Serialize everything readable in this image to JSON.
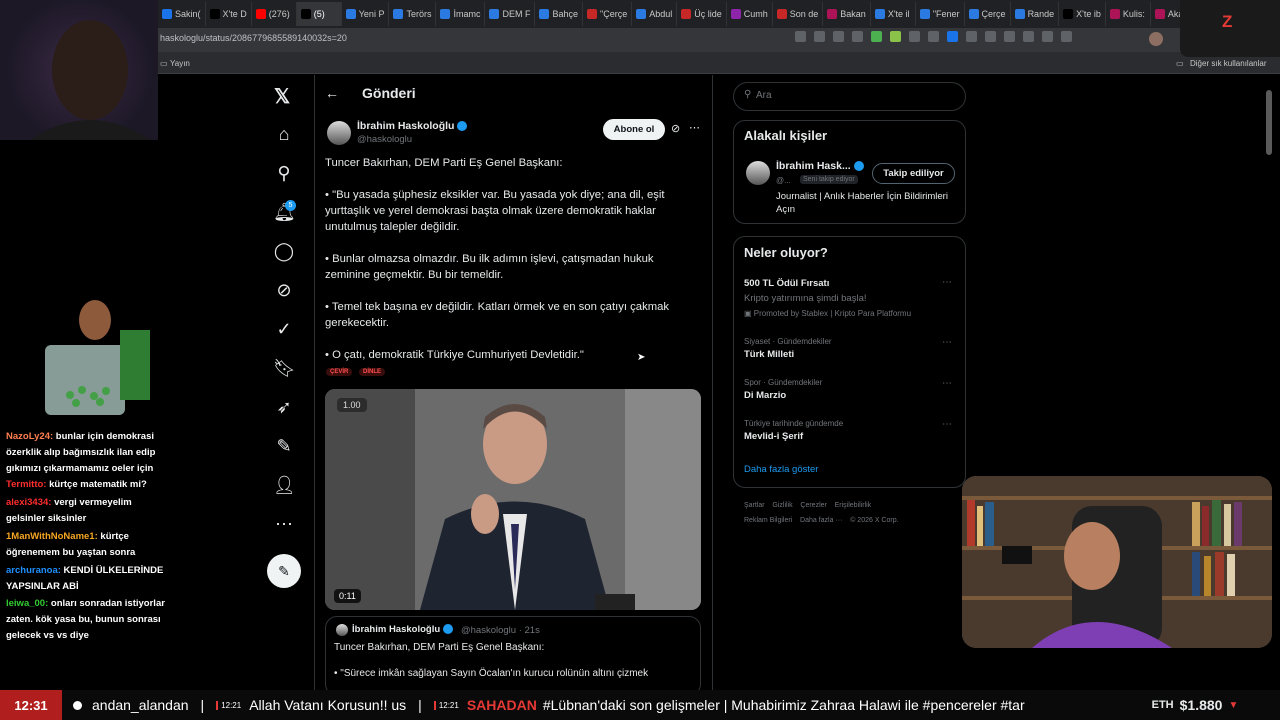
{
  "browser": {
    "tabs": [
      {
        "label": "Sakin(",
        "color": "#1a73e8"
      },
      {
        "label": "X'te D",
        "color": "#000000"
      },
      {
        "label": "(276)",
        "color": "#ff0000"
      },
      {
        "label": "(5)",
        "color": "#000000",
        "active": true
      },
      {
        "label": "Yeni P",
        "color": "#2a7ae2"
      },
      {
        "label": "Terörs",
        "color": "#2a7ae2"
      },
      {
        "label": "İmamc",
        "color": "#2a7ae2"
      },
      {
        "label": "DEM F",
        "color": "#2a7ae2"
      },
      {
        "label": "Bahçe",
        "color": "#2a7ae2"
      },
      {
        "label": "\"Çerçe",
        "color": "#c62828"
      },
      {
        "label": "Abdul",
        "color": "#2a7ae2"
      },
      {
        "label": "Üç lide",
        "color": "#c62828"
      },
      {
        "label": "Cumh",
        "color": "#8e24aa"
      },
      {
        "label": "Son de",
        "color": "#c62828"
      },
      {
        "label": "Bakan",
        "color": "#ad1457"
      },
      {
        "label": "X'te il",
        "color": "#2a7ae2"
      },
      {
        "label": "\"Fener",
        "color": "#2a7ae2"
      },
      {
        "label": "Çerçe",
        "color": "#2a7ae2"
      },
      {
        "label": "Rande",
        "color": "#2a7ae2"
      },
      {
        "label": "X'te ib",
        "color": "#000000"
      },
      {
        "label": "Kulis:",
        "color": "#ad1457"
      },
      {
        "label": "Akary",
        "color": "#ad1457"
      }
    ],
    "url": "haskologlu/status/2086779685589140032s=20",
    "bookmark_left": "Yayın",
    "bookmark_right": "Diğer sık kullanılanlar"
  },
  "x": {
    "header": "Gönderi",
    "author_name": "İbrahim Haskoloğlu",
    "author_handle": "@haskologlu",
    "subscribe": "Abone ol",
    "tweet_lines": [
      "Tuncer Bakırhan, DEM Parti Eş Genel Başkanı:",
      "• \"Bu yasada şüphesiz eksikler var. Bu yasada yok diye; ana dil, eşit yurttaşlık ve yerel demokrasi başta olmak üzere demokratik haklar unutulmuş talepler değildir.",
      "• Bunlar olmazsa olmazdır. Bu ilk adımın işlevi, çatışmadan hukuk zeminine geçmektir. Bu bir temeldir.",
      "• Temel tek başına ev değildir. Katları örmek ve en son çatıyı çakmak gerekecektir.",
      "• O çatı, demokratik Türkiye Cumhuriyeti Devletidir.\""
    ],
    "translate": "ÇEVİR",
    "listen": "DİNLE",
    "video_speed": "1.00",
    "video_time": "0:11",
    "quoted": {
      "name": "İbrahim Haskoloğlu",
      "handle": "@haskologlu · 21s",
      "line1": "Tuncer Bakırhan, DEM Parti Eş Genel Başkanı:",
      "line2": "• \"Sürece imkân sağlayan Sayın Öcalan'ın kurucu rolünün altını çizmek"
    },
    "notification_count": "5",
    "search_placeholder": "Ara",
    "relevant_title": "Alakalı kişiler",
    "relevant_name": "İbrahim Hask...",
    "relevant_handle": "@...",
    "relevant_follows_you": "Seni takip ediyor",
    "relevant_bio": "Journalist | Anlık Haberler İçin Bildirimleri Açın",
    "following_btn": "Takip ediliyor",
    "trends_title": "Neler oluyor?",
    "trends": [
      {
        "cat": "",
        "title": "500 TL Ödül Fırsatı",
        "sub": "Kripto yatırımına şimdi başla!",
        "promo": "Promoted by Stablex | Kripto Para Platformu"
      },
      {
        "cat": "Siyaset · Gündemdekiler",
        "title": "Türk Milleti"
      },
      {
        "cat": "Spor · Gündemdekiler",
        "title": "Di Marzio"
      },
      {
        "cat": "Türkiye tarihinde gündemde",
        "title": "Mevlid-i Şerif"
      }
    ],
    "show_more": "Daha fazla göster",
    "footer1": "Şartlar    Gizlilik    Çerezler    Erişilebilirlik",
    "footer2": "Reklam Bilgileri    Daha fazla ···    © 2026 X Corp."
  },
  "chat": [
    {
      "user": "NazoLy24:",
      "msg": " bunlar için demokrasi özerklik alıp bağımsızlık ilan edip gıkımızı çıkarmamamız oeler için",
      "color": "#ff7f50"
    },
    {
      "user": "Termitto:",
      "msg": " kürtçe matematik mi?",
      "color": "#ff2d2d"
    },
    {
      "user": "alexi3434:",
      "msg": " vergi vermeyelim gelsinler siksinler",
      "color": "#ff2d2d"
    },
    {
      "user": "1ManWithNoName1:",
      "msg": " kürtçe öğrenemem bu yaştan sonra",
      "color": "#f5a623"
    },
    {
      "user": "archuranoa:",
      "msg": " KENDİ ÜLKELERİNDE YAPSINLAR ABİ",
      "color": "#1e90ff"
    },
    {
      "user": "leiwa_00:",
      "msg": " onları sonradan istiyorlar zaten. kök yasa bu, bunun sonrası gelecek vs vs diye",
      "color": "#32cd32"
    }
  ],
  "ticker": {
    "clock": "12:31",
    "items": [
      {
        "time": "",
        "text": "andan_alandan"
      },
      {
        "time": "12:21",
        "text": "Allah Vatanı Korusun!! us"
      },
      {
        "time": "12:21",
        "tag": "SAHADAN",
        "text": "#Lübnan'daki son gelişmeler | Muhabirimiz Zahraa Halawi ile #pencereler #tar"
      }
    ],
    "crypto": "ETH",
    "price": "$1.880"
  }
}
